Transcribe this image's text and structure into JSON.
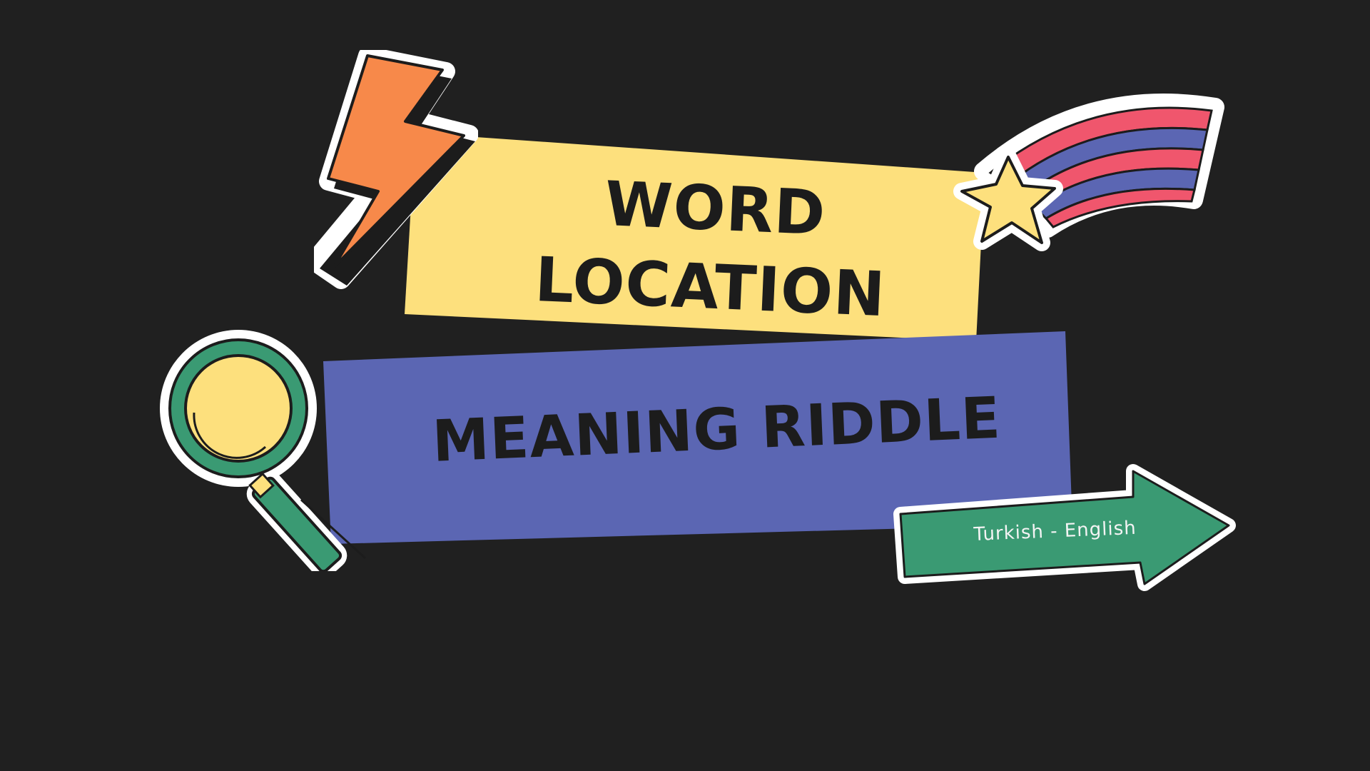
{
  "title": {
    "line1": "WORD",
    "line2": "LOCATION",
    "subtitle": "MEANING RIDDLE"
  },
  "language_arrow": {
    "label": "Turkish - English"
  },
  "stickers": {
    "lightning": "lightning-bolt-icon",
    "rainbow_star": "shooting-star-rainbow-icon",
    "magnifier": "magnifying-glass-icon",
    "arrow": "arrow-right-icon"
  },
  "colors": {
    "background": "#202020",
    "yellow_banner": "#fde07d",
    "blue_banner": "#5b66b3",
    "green_arrow": "#3a9a73",
    "orange_bolt": "#f7894a",
    "rainbow_red": "#f0566d",
    "rainbow_blue": "#5b66b3",
    "star_yellow": "#fde07d"
  }
}
